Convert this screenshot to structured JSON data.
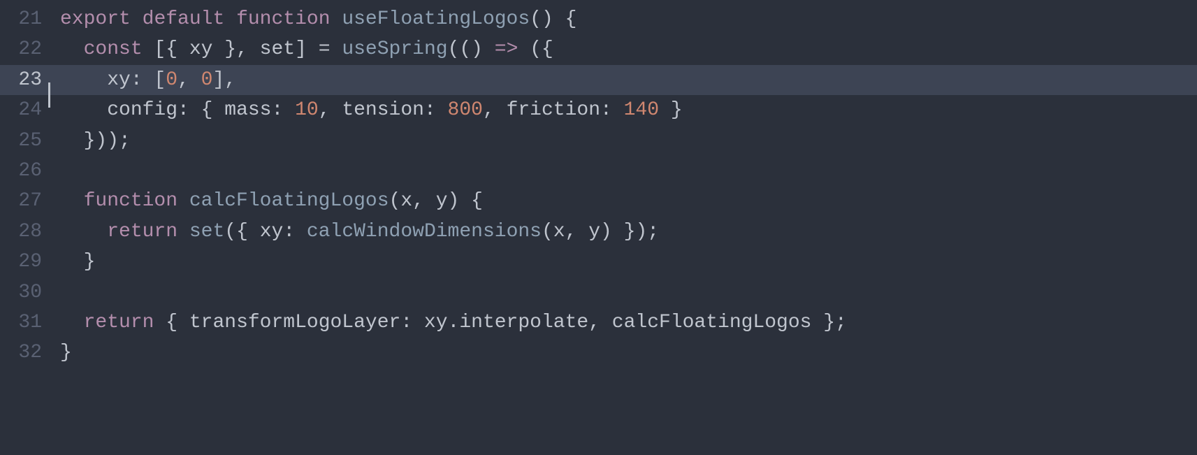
{
  "editor": {
    "lines": [
      {
        "num": "21",
        "active": false,
        "cursor": false,
        "tokens": [
          {
            "cls": "kw",
            "t": "export"
          },
          {
            "cls": "punc",
            "t": " "
          },
          {
            "cls": "kw",
            "t": "default"
          },
          {
            "cls": "punc",
            "t": " "
          },
          {
            "cls": "kw",
            "t": "function"
          },
          {
            "cls": "punc",
            "t": " "
          },
          {
            "cls": "fn",
            "t": "useFloatingLogos"
          },
          {
            "cls": "punc",
            "t": "() {"
          }
        ]
      },
      {
        "num": "22",
        "active": false,
        "cursor": false,
        "tokens": [
          {
            "cls": "punc",
            "t": "  "
          },
          {
            "cls": "kw",
            "t": "const"
          },
          {
            "cls": "punc",
            "t": " [{ "
          },
          {
            "cls": "ident",
            "t": "xy"
          },
          {
            "cls": "punc",
            "t": " }, "
          },
          {
            "cls": "ident",
            "t": "set"
          },
          {
            "cls": "punc",
            "t": "] "
          },
          {
            "cls": "op",
            "t": "="
          },
          {
            "cls": "punc",
            "t": " "
          },
          {
            "cls": "call",
            "t": "useSpring"
          },
          {
            "cls": "punc",
            "t": "(() "
          },
          {
            "cls": "kw",
            "t": "=>"
          },
          {
            "cls": "punc",
            "t": " ({"
          }
        ]
      },
      {
        "num": "23",
        "active": true,
        "cursor": true,
        "tokens": [
          {
            "cls": "punc",
            "t": "    "
          },
          {
            "cls": "prop",
            "t": "xy"
          },
          {
            "cls": "punc",
            "t": ": ["
          },
          {
            "cls": "num",
            "t": "0"
          },
          {
            "cls": "punc",
            "t": ", "
          },
          {
            "cls": "num",
            "t": "0"
          },
          {
            "cls": "punc",
            "t": "],"
          }
        ]
      },
      {
        "num": "24",
        "active": false,
        "cursor": false,
        "tokens": [
          {
            "cls": "punc",
            "t": "    "
          },
          {
            "cls": "prop",
            "t": "config"
          },
          {
            "cls": "punc",
            "t": ": { "
          },
          {
            "cls": "prop",
            "t": "mass"
          },
          {
            "cls": "punc",
            "t": ": "
          },
          {
            "cls": "num",
            "t": "10"
          },
          {
            "cls": "punc",
            "t": ", "
          },
          {
            "cls": "prop",
            "t": "tension"
          },
          {
            "cls": "punc",
            "t": ": "
          },
          {
            "cls": "num",
            "t": "800"
          },
          {
            "cls": "punc",
            "t": ", "
          },
          {
            "cls": "prop",
            "t": "friction"
          },
          {
            "cls": "punc",
            "t": ": "
          },
          {
            "cls": "num",
            "t": "140"
          },
          {
            "cls": "punc",
            "t": " }"
          }
        ]
      },
      {
        "num": "25",
        "active": false,
        "cursor": false,
        "tokens": [
          {
            "cls": "punc",
            "t": "  }));"
          }
        ]
      },
      {
        "num": "26",
        "active": false,
        "cursor": false,
        "tokens": [
          {
            "cls": "punc",
            "t": ""
          }
        ]
      },
      {
        "num": "27",
        "active": false,
        "cursor": false,
        "tokens": [
          {
            "cls": "punc",
            "t": "  "
          },
          {
            "cls": "kw",
            "t": "function"
          },
          {
            "cls": "punc",
            "t": " "
          },
          {
            "cls": "fn",
            "t": "calcFloatingLogos"
          },
          {
            "cls": "punc",
            "t": "("
          },
          {
            "cls": "ident",
            "t": "x"
          },
          {
            "cls": "punc",
            "t": ", "
          },
          {
            "cls": "ident",
            "t": "y"
          },
          {
            "cls": "punc",
            "t": ") {"
          }
        ]
      },
      {
        "num": "28",
        "active": false,
        "cursor": false,
        "tokens": [
          {
            "cls": "punc",
            "t": "    "
          },
          {
            "cls": "kw",
            "t": "return"
          },
          {
            "cls": "punc",
            "t": " "
          },
          {
            "cls": "call",
            "t": "set"
          },
          {
            "cls": "punc",
            "t": "({ "
          },
          {
            "cls": "prop",
            "t": "xy"
          },
          {
            "cls": "punc",
            "t": ": "
          },
          {
            "cls": "call",
            "t": "calcWindowDimensions"
          },
          {
            "cls": "punc",
            "t": "("
          },
          {
            "cls": "ident",
            "t": "x"
          },
          {
            "cls": "punc",
            "t": ", "
          },
          {
            "cls": "ident",
            "t": "y"
          },
          {
            "cls": "punc",
            "t": ") });"
          }
        ]
      },
      {
        "num": "29",
        "active": false,
        "cursor": false,
        "tokens": [
          {
            "cls": "punc",
            "t": "  }"
          }
        ]
      },
      {
        "num": "30",
        "active": false,
        "cursor": false,
        "tokens": [
          {
            "cls": "punc",
            "t": ""
          }
        ]
      },
      {
        "num": "31",
        "active": false,
        "cursor": false,
        "tokens": [
          {
            "cls": "punc",
            "t": "  "
          },
          {
            "cls": "kw",
            "t": "return"
          },
          {
            "cls": "punc",
            "t": " { "
          },
          {
            "cls": "prop",
            "t": "transformLogoLayer"
          },
          {
            "cls": "punc",
            "t": ": "
          },
          {
            "cls": "ident",
            "t": "xy"
          },
          {
            "cls": "punc",
            "t": "."
          },
          {
            "cls": "ident",
            "t": "interpolate"
          },
          {
            "cls": "punc",
            "t": ", "
          },
          {
            "cls": "ident",
            "t": "calcFloatingLogos"
          },
          {
            "cls": "punc",
            "t": " };"
          }
        ]
      },
      {
        "num": "32",
        "active": false,
        "cursor": false,
        "tokens": [
          {
            "cls": "punc",
            "t": "}"
          }
        ]
      }
    ]
  }
}
